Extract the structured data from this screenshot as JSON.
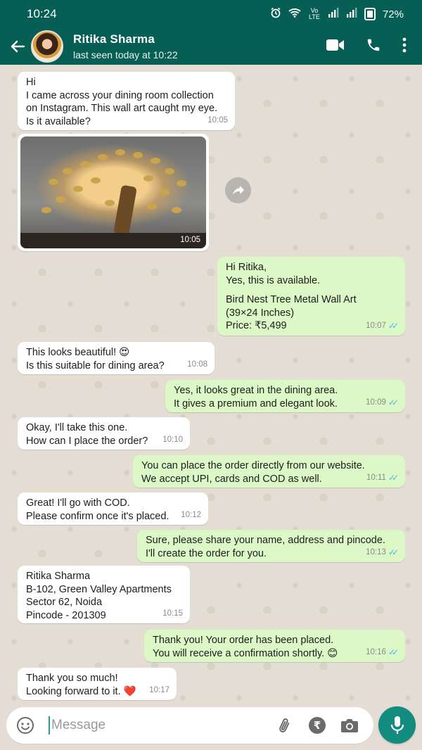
{
  "status_bar": {
    "time": "10:24",
    "network_label": "Vo LTE",
    "battery": "72%"
  },
  "header": {
    "contact_name": "Ritika Sharma",
    "last_seen": "last seen today at 10:22"
  },
  "messages": [
    {
      "dir": "in",
      "lines": [
        "Hi",
        "I came across your dining room collection",
        "on Instagram. This wall art caught my eye.",
        "Is it available?"
      ],
      "time": "10:05"
    },
    {
      "dir": "in",
      "type": "image",
      "time": "10:05"
    },
    {
      "dir": "out",
      "lines": [
        "Hi Ritika,",
        "Yes, this is available.",
        "",
        "Bird Nest Tree Metal Wall Art",
        "(39×24 Inches)",
        "Price: ₹5,499"
      ],
      "time": "10:07"
    },
    {
      "dir": "in",
      "lines": [
        "This looks beautiful! 😍",
        "Is this suitable for dining area?"
      ],
      "time": "10:08"
    },
    {
      "dir": "out",
      "lines": [
        "Yes, it looks great in the dining area.",
        "It gives a premium and elegant look."
      ],
      "time": "10:09"
    },
    {
      "dir": "in",
      "lines": [
        "Okay, I'll take this one.",
        "How can I place the order?"
      ],
      "time": "10:10"
    },
    {
      "dir": "out",
      "lines": [
        "You can place the order directly from our website.",
        "We accept UPI, cards and COD as well."
      ],
      "time": "10:11"
    },
    {
      "dir": "in",
      "lines": [
        "Great! I'll go with COD.",
        "Please confirm once it's placed."
      ],
      "time": "10:12"
    },
    {
      "dir": "out",
      "lines": [
        "Sure, please share your name, address and pincode.",
        "I'll create the order for you."
      ],
      "time": "10:13"
    },
    {
      "dir": "in",
      "lines": [
        "Ritika Sharma",
        "B-102, Green Valley Apartments",
        "Sector 62, Noida",
        "Pincode - 201309"
      ],
      "time": "10:15"
    },
    {
      "dir": "out",
      "lines": [
        "Thank you! Your order has been placed.",
        "You will receive a confirmation shortly. 😊"
      ],
      "time": "10:16"
    },
    {
      "dir": "in",
      "lines": [
        "Thank you so much!",
        "Looking forward to it. ❤️"
      ],
      "time": "10:17"
    }
  ],
  "composer": {
    "placeholder": "Message"
  },
  "icons": {
    "back": "arrow-left-icon",
    "video": "video-call-icon",
    "call": "phone-icon",
    "menu": "more-vert-icon",
    "emoji": "emoji-icon",
    "attach": "paperclip-icon",
    "payment": "rupee-icon",
    "camera": "camera-icon",
    "mic": "mic-icon",
    "forward": "forward-icon"
  },
  "colors": {
    "header": "#075e54",
    "outgoing_bubble": "#dcf8c6",
    "incoming_bubble": "#ffffff",
    "mic_button": "#128c7e",
    "read_ticks": "#4fb6ec"
  }
}
